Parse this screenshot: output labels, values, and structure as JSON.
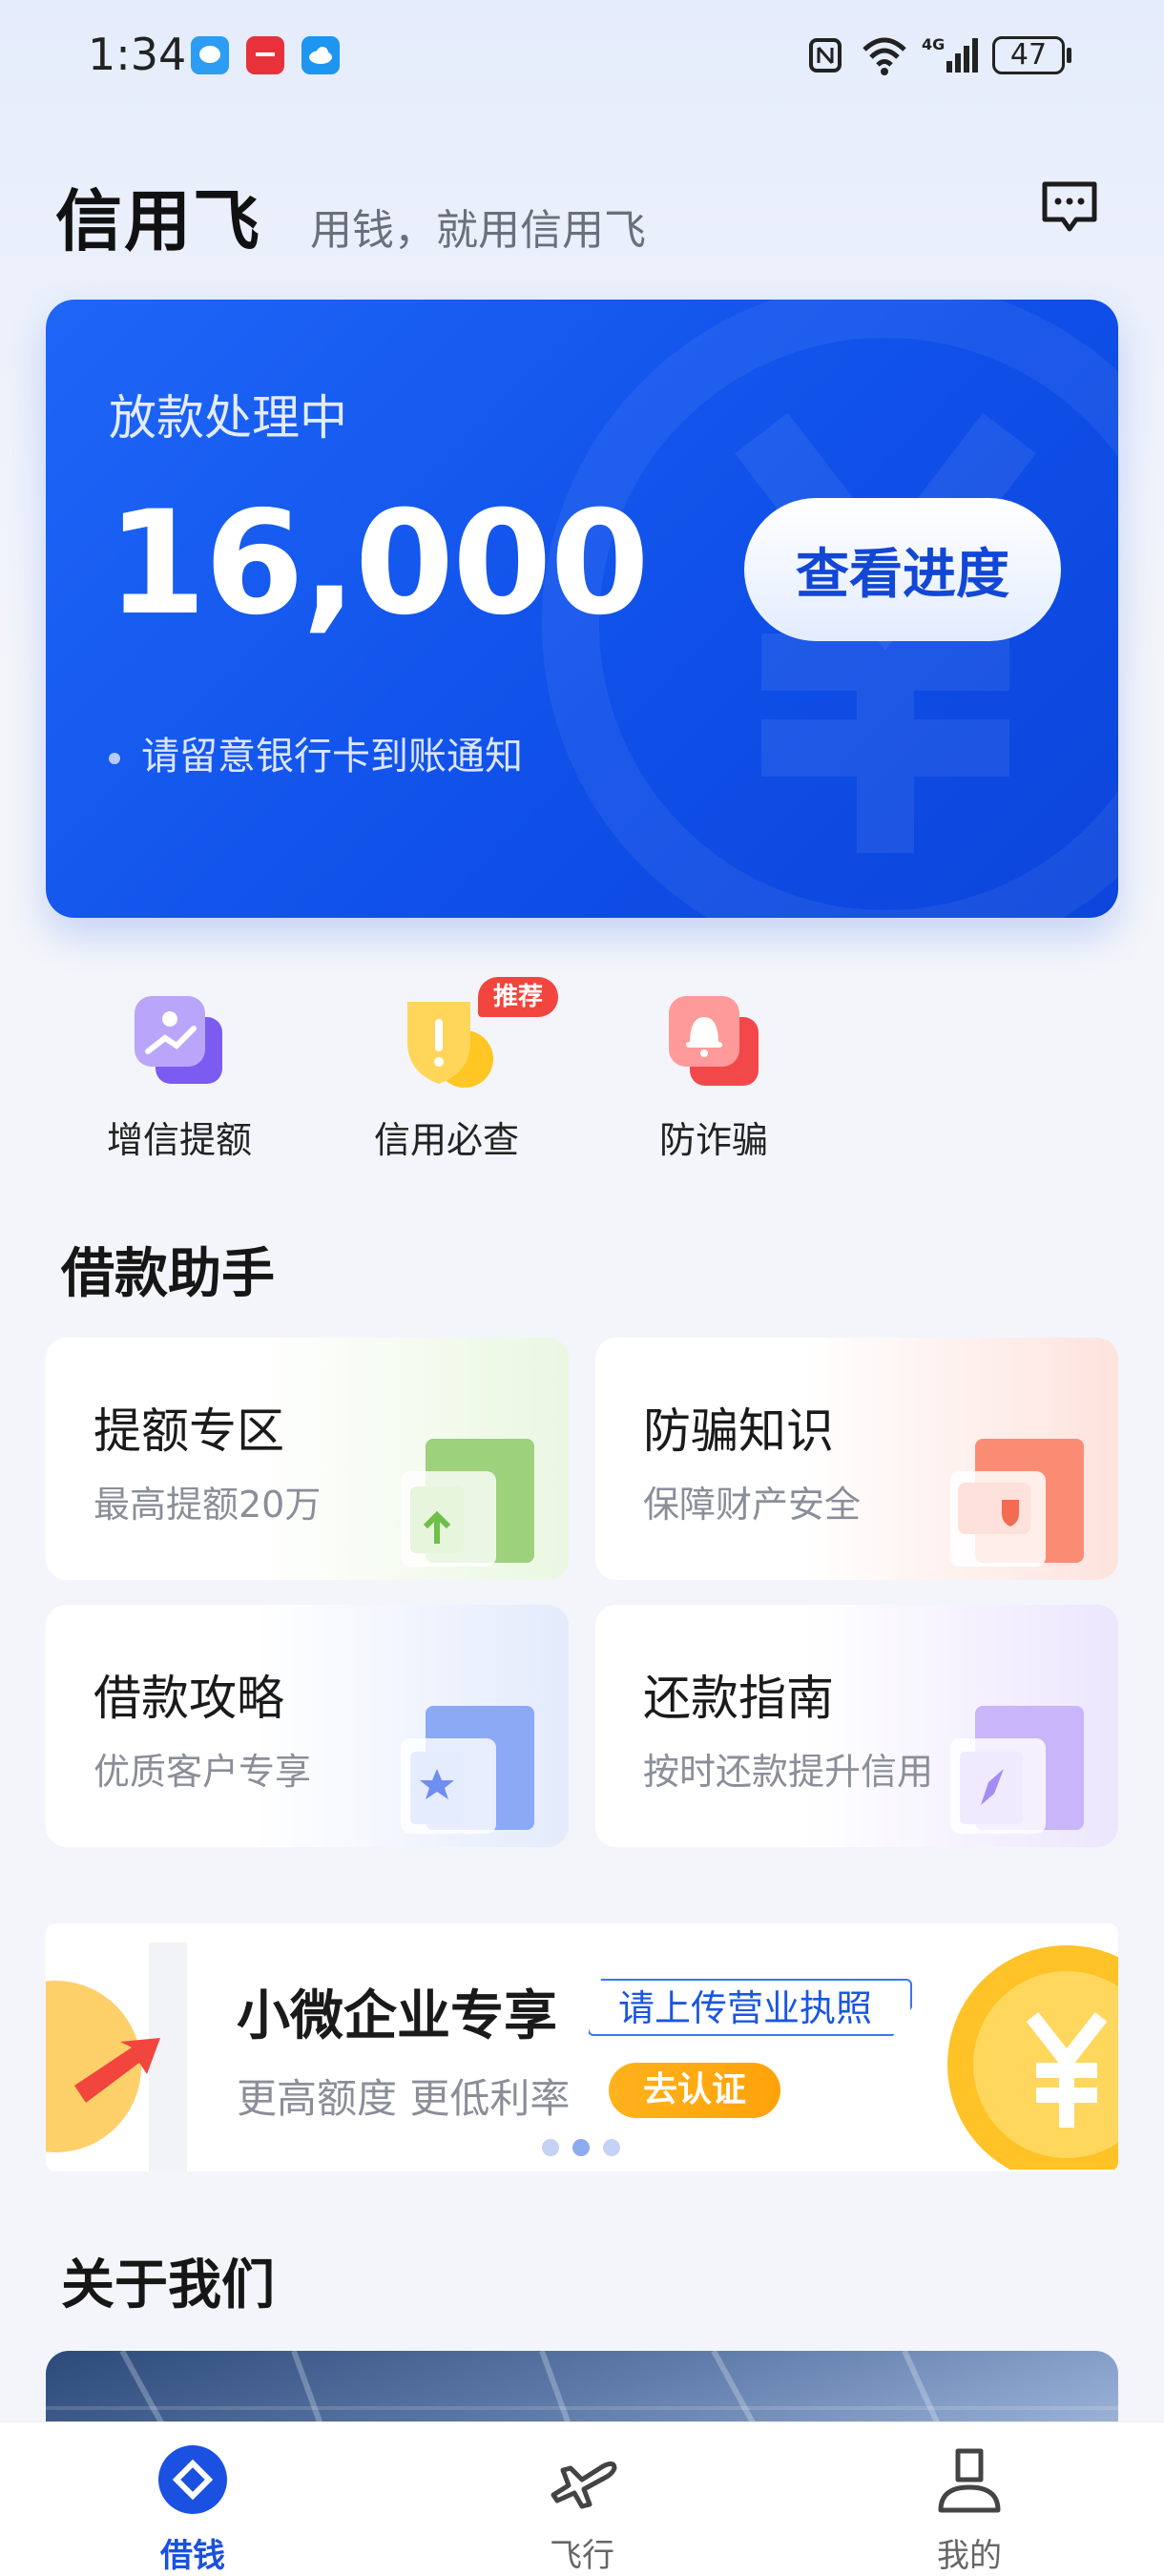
{
  "status_bar": {
    "time": "1:34",
    "battery": "47"
  },
  "header": {
    "brand": "信用飞",
    "slogan": "用钱，就用信用飞"
  },
  "loan_card": {
    "status": "放款处理中",
    "amount": "16,000",
    "button_label": "查看进度",
    "note": "请留意银行卡到账通知"
  },
  "quick_actions": [
    {
      "label": "增信提额"
    },
    {
      "label": "信用必查",
      "badge": "推荐"
    },
    {
      "label": "防诈骗"
    }
  ],
  "assistant": {
    "title": "借款助手",
    "tiles": [
      {
        "title": "提额专区",
        "subtitle": "最高提额20万"
      },
      {
        "title": "防骗知识",
        "subtitle": "保障财产安全"
      },
      {
        "title": "借款攻略",
        "subtitle": "优质客户专享"
      },
      {
        "title": "还款指南",
        "subtitle": "按时还款提升信用"
      }
    ]
  },
  "banner": {
    "title": "小微企业专享",
    "tag": "请上传营业执照",
    "subtitle": "更高额度 更低利率",
    "button": "去认证"
  },
  "about": {
    "title": "关于我们"
  },
  "bottom_nav": [
    {
      "label": "借钱",
      "active": true
    },
    {
      "label": "飞行",
      "active": false
    },
    {
      "label": "我的",
      "active": false
    }
  ],
  "colors": {
    "primary": "#1a51e0",
    "card_blue": "#1e66f7",
    "badge_red": "#f2453d",
    "accent_orange": "#ffa20a"
  }
}
